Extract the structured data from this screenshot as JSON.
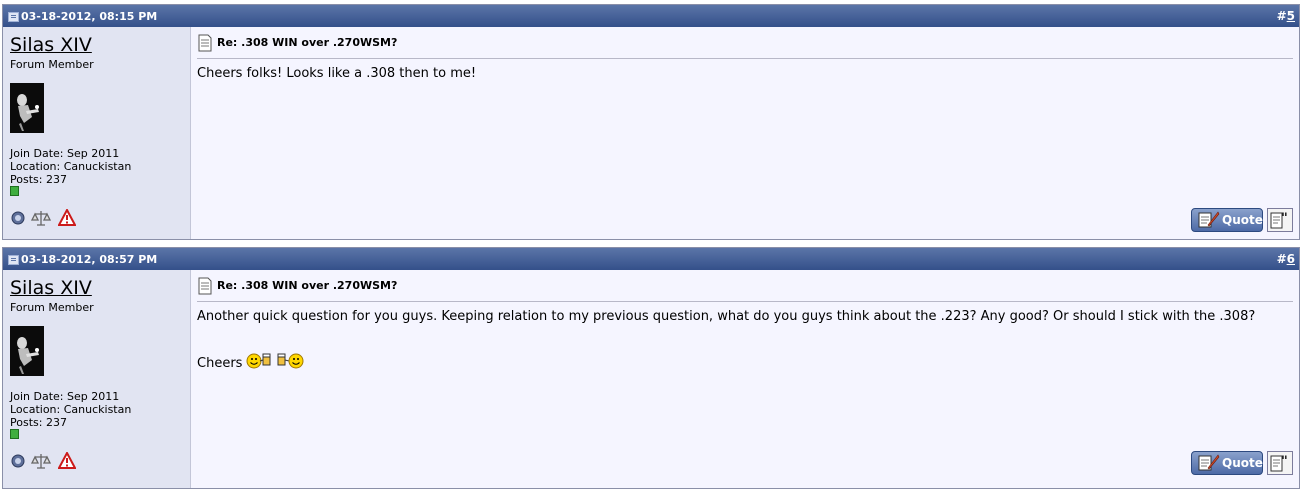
{
  "posts": [
    {
      "date": "03-18-2012, 08:15 PM",
      "number_prefix": "#",
      "number": "5",
      "username": "Silas XIV",
      "user_title": "Forum Member",
      "join_date": "Join Date: Sep 2011",
      "location": "Location: Canuckistan",
      "posts": "Posts: 237",
      "title": "Re: .308 WIN over .270WSM?",
      "message": [
        "Cheers folks! Looks like a .308 then to me!"
      ],
      "quote_label": "Quote"
    },
    {
      "date": "03-18-2012, 08:57 PM",
      "number_prefix": "#",
      "number": "6",
      "username": "Silas XIV",
      "user_title": "Forum Member",
      "join_date": "Join Date: Sep 2011",
      "location": "Location: Canuckistan",
      "posts": "Posts: 237",
      "title": "Re: .308 WIN over .270WSM?",
      "message": [
        "Another quick question for you guys. Keeping relation to my previous question, what do you guys think about the .223? Any good? Or should I stick with the .308?",
        "Cheers"
      ],
      "quote_label": "Quote"
    }
  ],
  "colors": {
    "header_bg": "#34508a",
    "panel_bg": "#e1e4f2",
    "content_bg": "#f5f5ff",
    "online": "#3fae3f"
  },
  "icons": [
    "doc-icon",
    "post-title-icon",
    "offline-status-icon",
    "reputation-icon",
    "report-icon",
    "quote-icon",
    "multi-quote-icon",
    "cheers-smiley-icon"
  ]
}
